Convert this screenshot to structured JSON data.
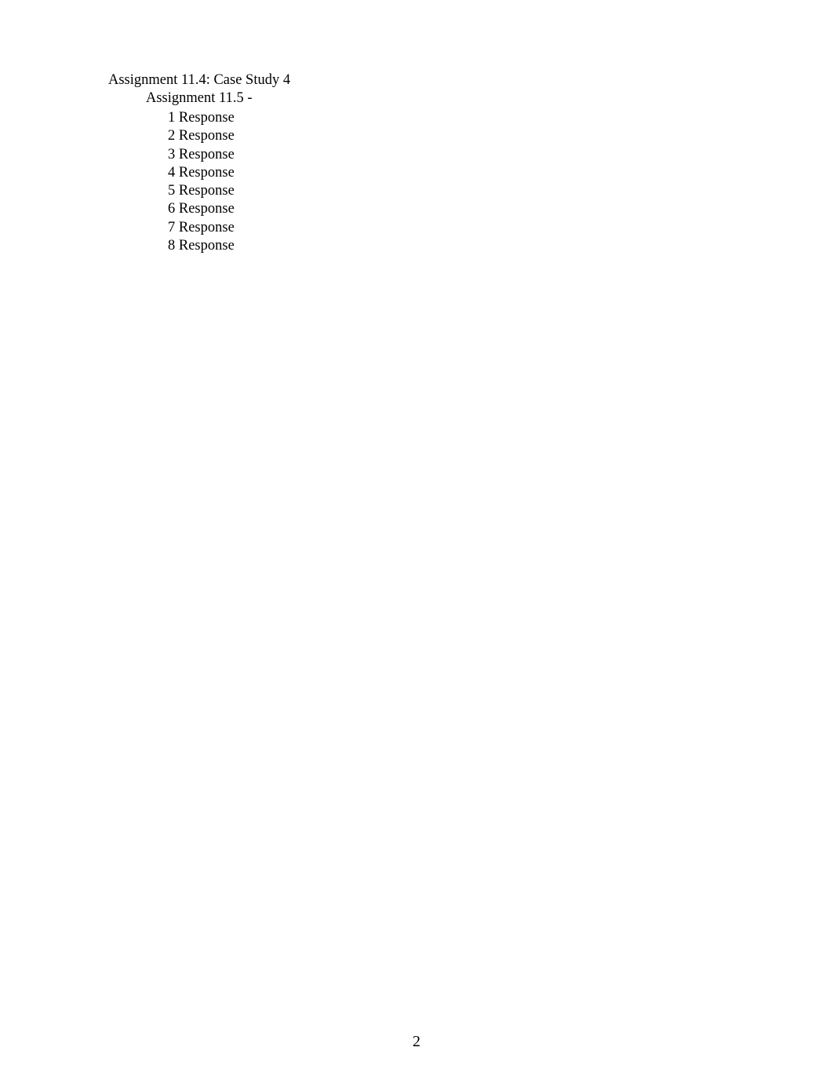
{
  "document": {
    "outline": {
      "level1": "Assignment 11.4: Case Study 4",
      "level2": "Assignment 11.5 -",
      "responses": [
        "1 Response",
        "2 Response",
        "3 Response",
        "4 Response",
        "5 Response",
        "6 Response",
        "7 Response",
        "8 Response"
      ]
    },
    "page_number": "2"
  }
}
